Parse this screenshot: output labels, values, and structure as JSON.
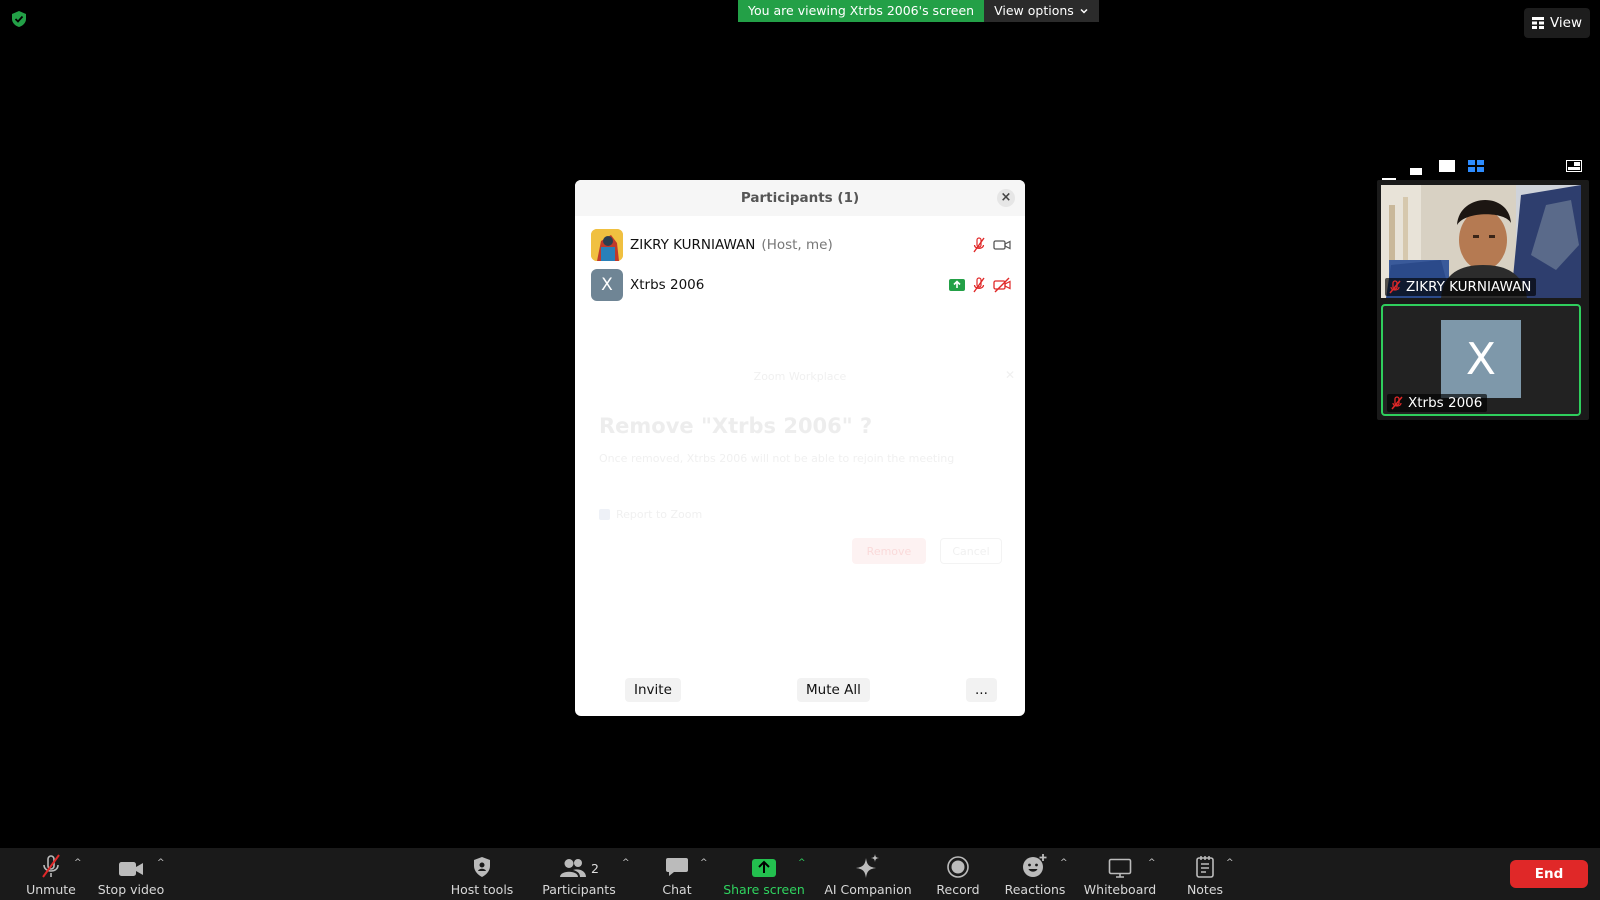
{
  "banner": {
    "viewing_text": "You are viewing Xtrbs 2006's screen",
    "view_options_label": "View options"
  },
  "top_right": {
    "view_label": "View"
  },
  "tiles": [
    {
      "name": "ZIKRY KURNIAWAN",
      "muted": true,
      "video": true
    },
    {
      "name": "Xtrbs 2006",
      "initial": "X",
      "muted": true,
      "video": false,
      "active_speaker": true
    }
  ],
  "participants_panel": {
    "title": "Participants (1)",
    "close_label": "×",
    "rows": [
      {
        "name": "ZIKRY KURNIAWAN",
        "role": "(Host, me)",
        "icons": [
          "mic-muted-icon",
          "video-on-icon"
        ]
      },
      {
        "name": "Xtrbs 2006",
        "initial": "X",
        "icons": [
          "share-screen-icon",
          "mic-muted-icon",
          "video-off-icon"
        ]
      }
    ],
    "faded_dialog": {
      "window_title": "Zoom Workplace",
      "heading": "Remove \"Xtrbs 2006\" ?",
      "body": "Once removed, Xtrbs 2006 will not be able to rejoin the meeting",
      "checkbox_label": "Report to Zoom",
      "remove_label": "Remove",
      "cancel_label": "Cancel"
    },
    "footer": {
      "invite_label": "Invite",
      "mute_all_label": "Mute All",
      "more_label": "..."
    }
  },
  "toolbar": {
    "unmute": "Unmute",
    "stop_video": "Stop video",
    "host_tools": "Host tools",
    "participants": "Participants",
    "participants_count": "2",
    "chat": "Chat",
    "share_screen": "Share screen",
    "ai_companion": "AI Companion",
    "record": "Record",
    "reactions": "Reactions",
    "whiteboard": "Whiteboard",
    "notes": "Notes",
    "end": "End"
  },
  "colors": {
    "share_green": "#23a047",
    "end_red": "#e02828",
    "muted_red": "#e02828",
    "active_speaker_border": "#2fcf5d",
    "layout_icon_active": "#2d8cff"
  }
}
